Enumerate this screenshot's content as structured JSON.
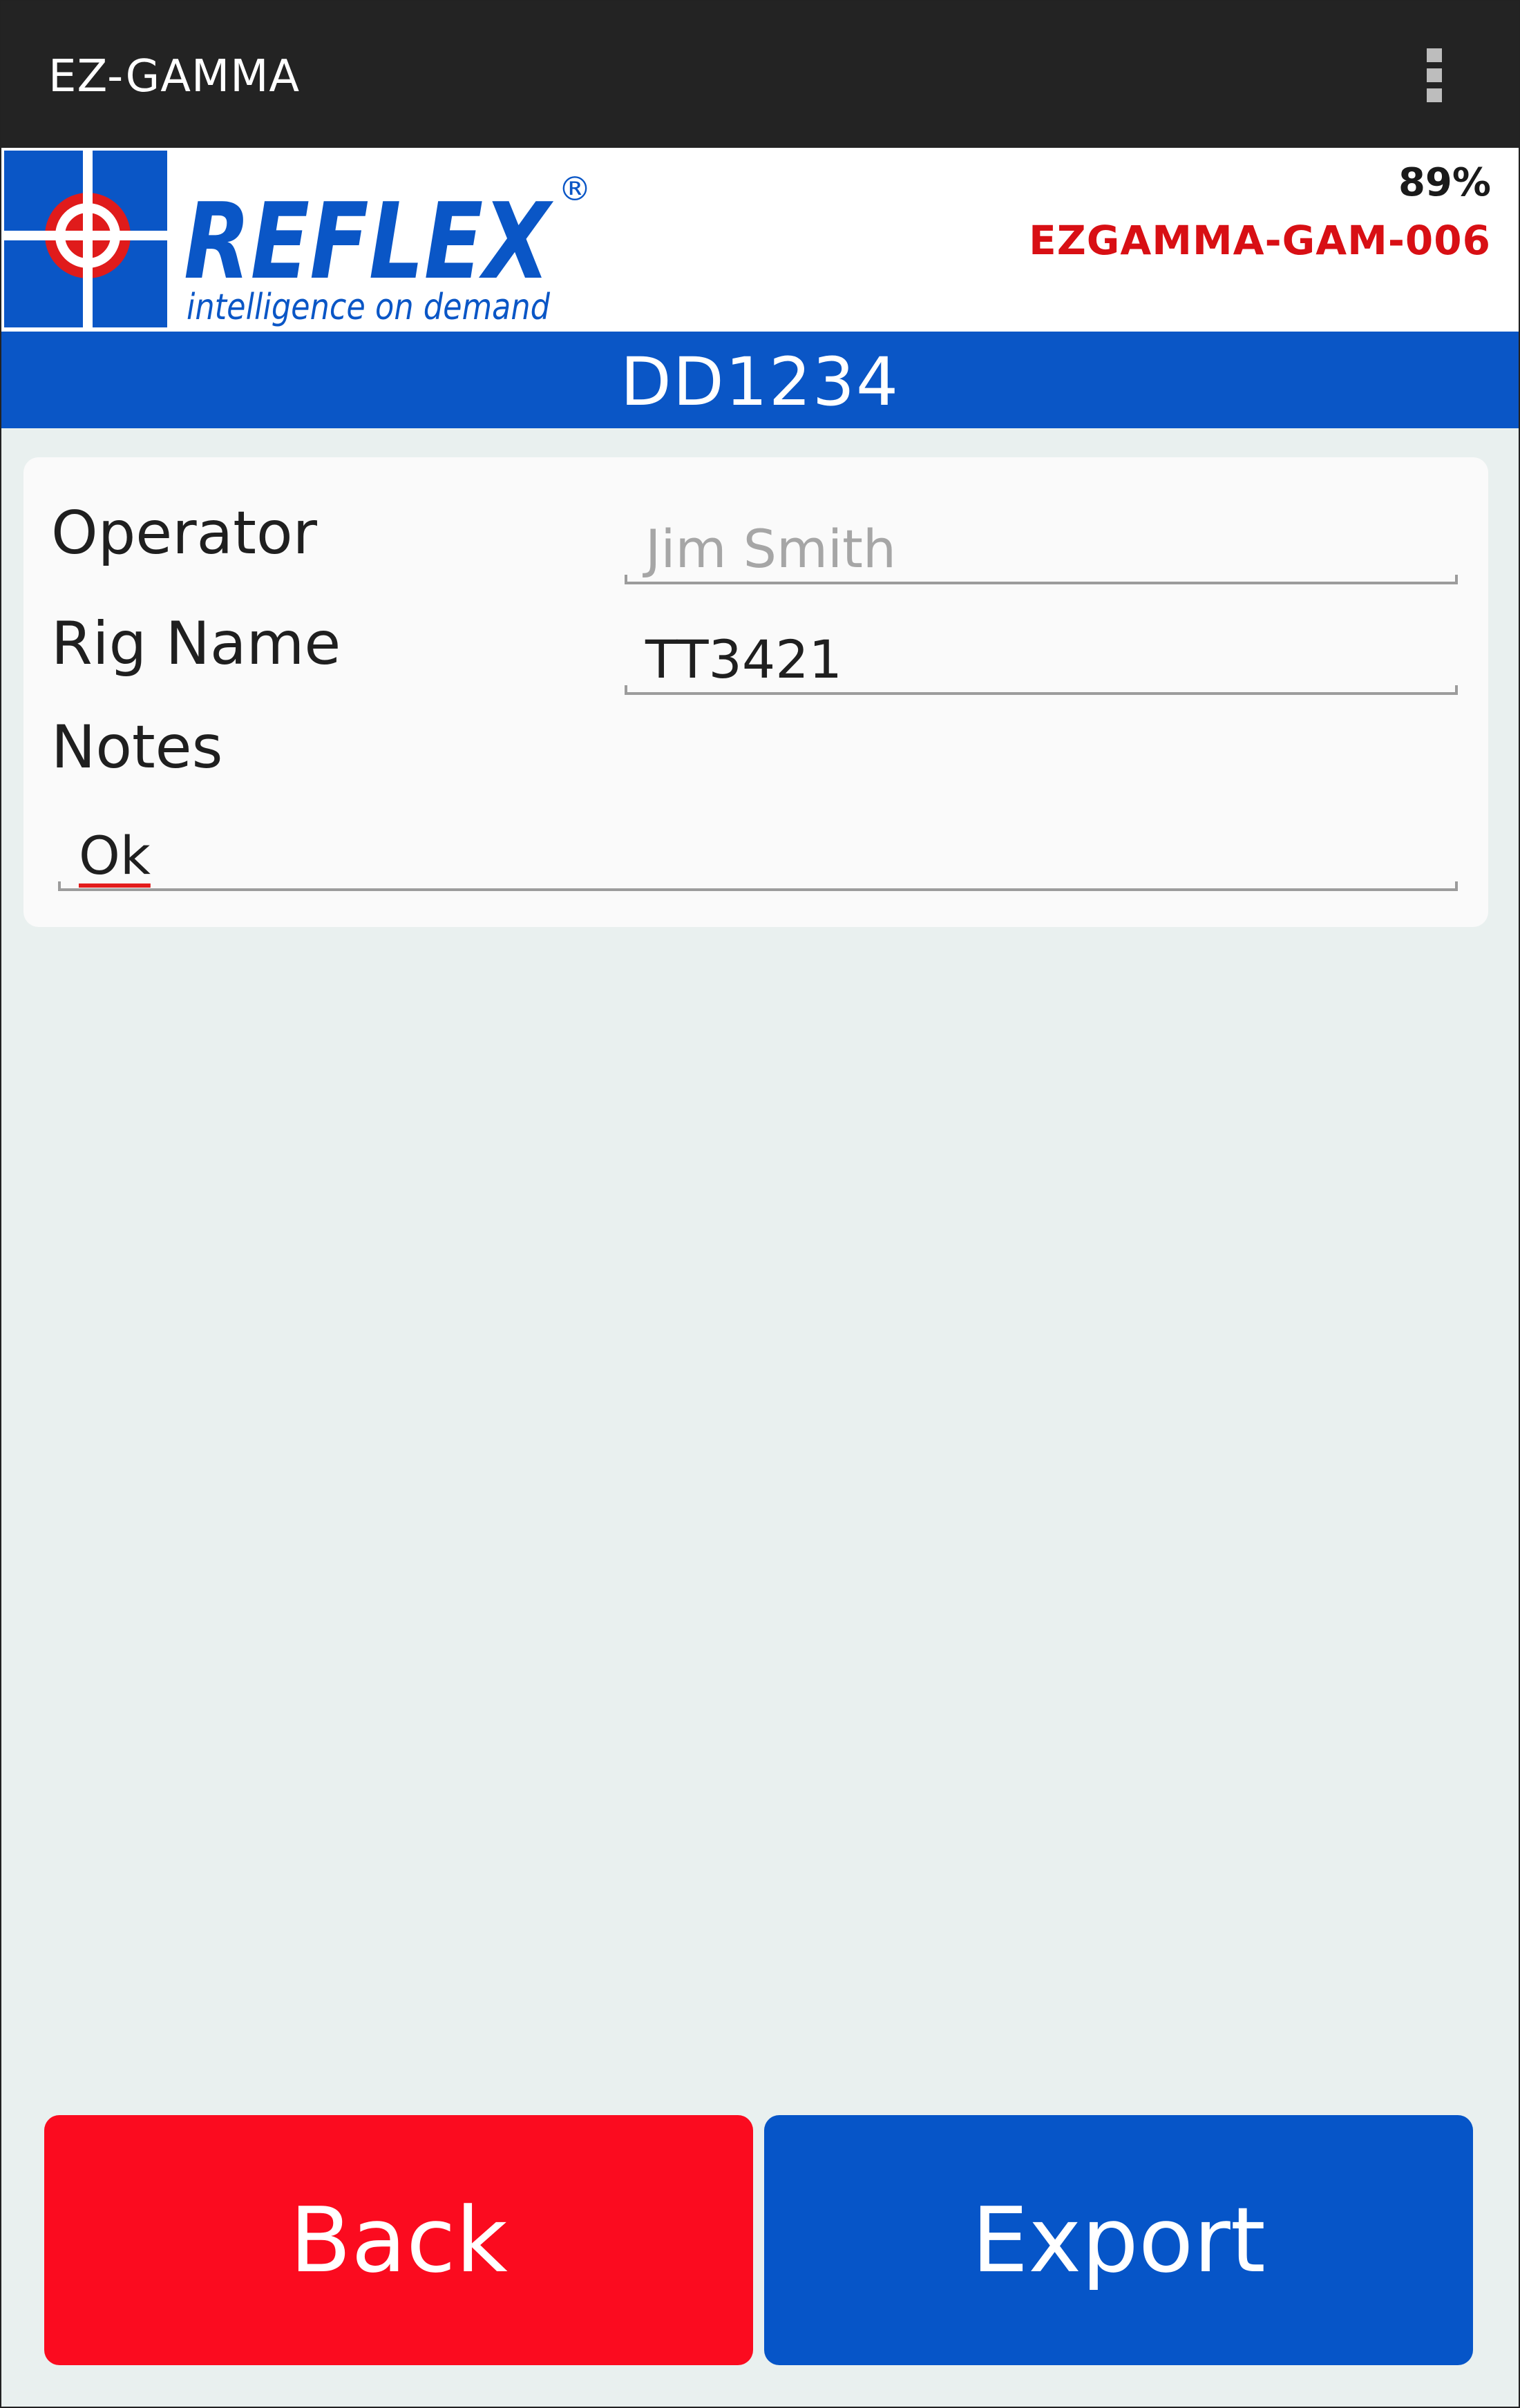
{
  "app": {
    "title": "EZ-GAMMA",
    "overflow_icon": "overflow-menu-icon"
  },
  "header": {
    "logo_word": "REFLEX",
    "logo_tagline": "intelligence on demand",
    "logo_mark": "®",
    "battery": "89%",
    "device_id": "EZGAMMA-GAM-006"
  },
  "hole_id": "DD1234",
  "form": {
    "operator_label": "Operator",
    "operator_value": "Jim Smith",
    "rig_label": "Rig Name",
    "rig_value": "TT3421",
    "notes_label": "Notes",
    "notes_value": "Ok"
  },
  "buttons": {
    "back": "Back",
    "export": "Export"
  },
  "colors": {
    "brand_blue": "#0a56c6",
    "back_red": "#fb0b1f",
    "device_red": "#d80f14",
    "action_bar": "#232323"
  }
}
